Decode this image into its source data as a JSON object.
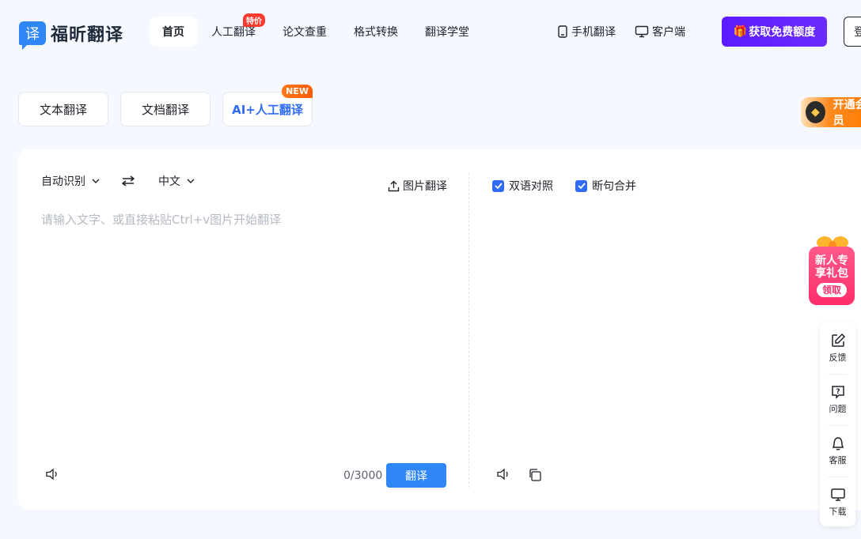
{
  "logo": {
    "mark": "译",
    "text": "福昕翻译"
  },
  "nav": [
    {
      "label": "首页",
      "active": true
    },
    {
      "label": "人工翻译",
      "badge": "特价"
    },
    {
      "label": "论文查重"
    },
    {
      "label": "格式转换"
    },
    {
      "label": "翻译学堂"
    }
  ],
  "header_links": {
    "mobile": "手机翻译",
    "client": "客户端"
  },
  "cta_label": "获取免费额度",
  "login_label": "登录",
  "modes": {
    "text": "文本翻译",
    "doc": "文档翻译",
    "ai": "AI+人工翻译",
    "ai_badge": "NEW"
  },
  "vip_label": "开通会员",
  "translator": {
    "source_lang": "自动识别",
    "target_lang": "中文",
    "image_translate": "图片翻译",
    "placeholder": "请输入文字、或直接粘贴Ctrl+v图片开始翻译",
    "counter": "0/3000",
    "translate_button": "翻译",
    "bilingual": "双语对照",
    "merge_sentences": "断句合并"
  },
  "gift": {
    "line1": "新人专",
    "line2": "享礼包",
    "get": "领取"
  },
  "side_panel": {
    "feedback": "反馈",
    "questions": "问题",
    "service": "客服",
    "download": "下载"
  },
  "colors": {
    "primary": "#2f86f6",
    "cta": "#5b1bff",
    "badge": "#ff3b30",
    "gift": "#ff2d6b"
  }
}
